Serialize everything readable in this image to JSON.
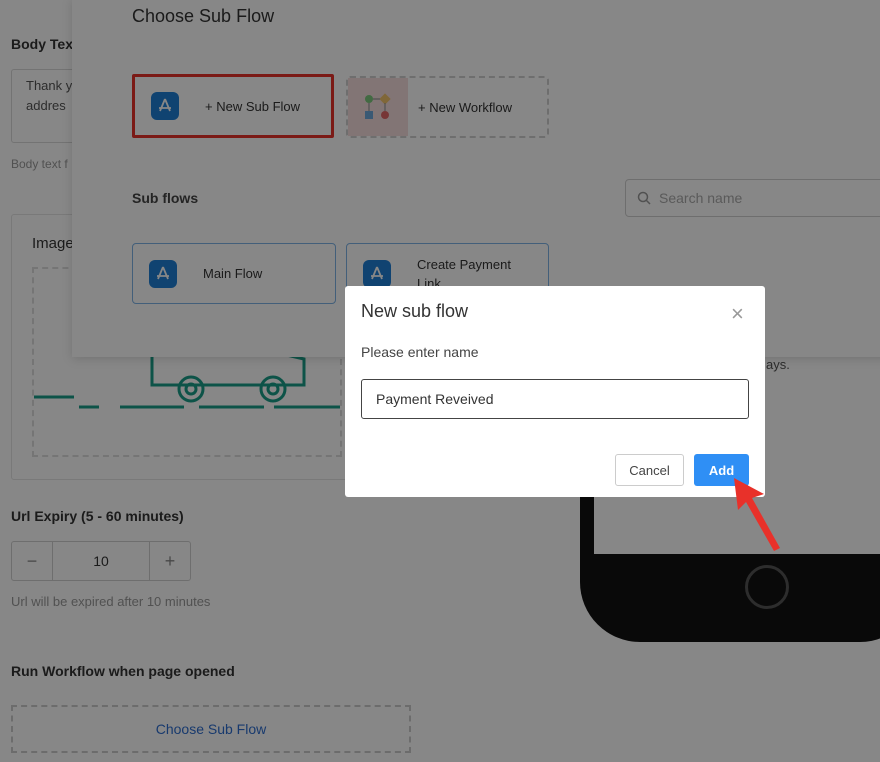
{
  "page": {
    "body_text_label": "Body Tex",
    "body_text_value": "Thank y\naddres",
    "body_text_hint": "Body text f",
    "image_label": "Image",
    "url_expiry_label": "Url Expiry (5 - 60 minutes)",
    "stepper_value": "10",
    "stepper_minus": "−",
    "stepper_plus": "+",
    "url_expiry_hint": "Url will be expired after 10 minutes",
    "run_workflow_label": "Run Workflow when page opened",
    "choose_sub_flow_button": "Choose Sub Flow",
    "side_text_fragment": "ays."
  },
  "sheet": {
    "title": "Choose Sub Flow",
    "new_sub_flow": "+ New Sub Flow",
    "new_workflow": "+ New Workflow",
    "sub_flows_heading": "Sub flows",
    "search_placeholder": "Search name",
    "flows": [
      {
        "label": "Main Flow"
      },
      {
        "label": "Create Payment Link"
      }
    ]
  },
  "dialog": {
    "title": "New sub flow",
    "close": "×",
    "field_label": "Please enter name",
    "input_value": "Payment Reveived",
    "cancel": "Cancel",
    "add": "Add"
  },
  "colors": {
    "primary": "#2f8ff5",
    "highlight_border": "#e8312a",
    "app_icon": "#1f7fd6",
    "truck": "#1a9e88"
  }
}
